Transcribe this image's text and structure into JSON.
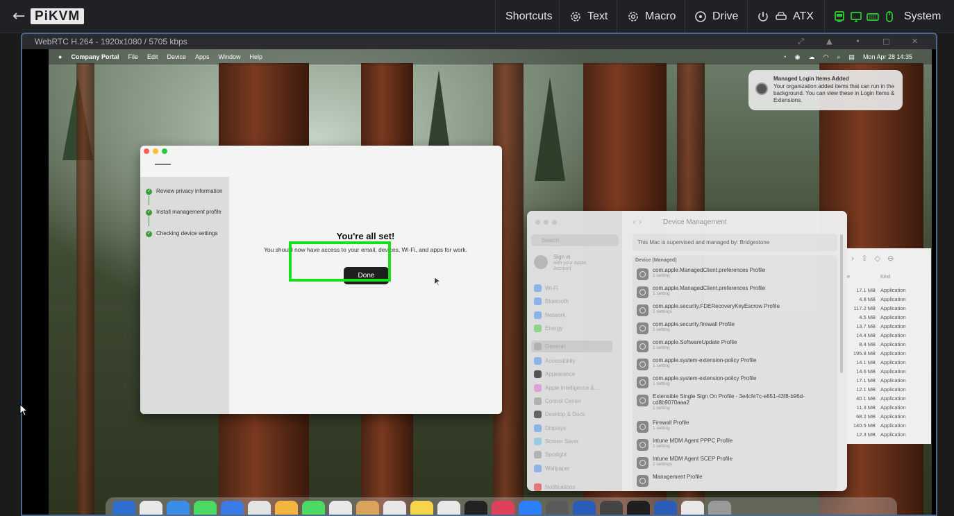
{
  "pikvm": {
    "logo": "PiKVM",
    "menu": {
      "shortcuts": "Shortcuts",
      "text": "Text",
      "macro": "Macro",
      "drive": "Drive",
      "atx": "ATX",
      "system": "System"
    }
  },
  "stream": {
    "info": "WebRTC H.264 - 1920x1080 / 5705 kbps"
  },
  "mac": {
    "menubar": {
      "app": "Company Portal",
      "items": [
        "File",
        "Edit",
        "Device",
        "Apps",
        "Window",
        "Help"
      ],
      "clock": "Mon Apr 28  14:35"
    },
    "notification": {
      "title": "Managed Login Items Added",
      "body": "Your organization added items that can run in the background. You can view these in Login Items & Extensions."
    },
    "company_portal": {
      "steps": [
        "Review privacy information",
        "Install management profile",
        "Checking device settings"
      ],
      "title": "You're all set!",
      "subtitle": "You should now have access to your email, devices, Wi-Fi, and apps for work.",
      "done_label": "Done"
    },
    "system_settings": {
      "search_placeholder": "Search",
      "signin": "Sign in",
      "signin_sub": "with your Apple Account",
      "sidebar": [
        "Wi-Fi",
        "Bluetooth",
        "Network",
        "Energy",
        "General",
        "Accessibility",
        "Appearance",
        "Apple Intelligence &...",
        "Control Center",
        "Desktop & Dock",
        "Displays",
        "Screen Saver",
        "Spotlight",
        "Wallpaper",
        "Notifications"
      ],
      "title": "Device Management",
      "supervised": "This Mac is supervised and managed by: Bridgestone",
      "list_header": "Device (Managed)",
      "profiles": [
        {
          "name": "com.apple.ManagedClient.preferences Profile",
          "settings": "1 setting"
        },
        {
          "name": "com.apple.ManagedClient.preferences Profile",
          "settings": "1 setting"
        },
        {
          "name": "com.apple.security.FDERecoveryKeyEscrow Profile",
          "settings": "2 settings"
        },
        {
          "name": "com.apple.security.firewall Profile",
          "settings": "1 setting"
        },
        {
          "name": "com.apple.SoftwareUpdate Profile",
          "settings": "1 setting"
        },
        {
          "name": "com.apple.system-extension-policy Profile",
          "settings": "1 setting"
        },
        {
          "name": "com.apple.system-extension-policy Profile",
          "settings": "1 setting"
        },
        {
          "name": "Extensible Single Sign On Profile - 3e4cfe7c-e851-43f8-b96d-cd8b9070aaa2",
          "settings": "1 setting"
        },
        {
          "name": "Firewall Profile",
          "settings": "1 setting"
        },
        {
          "name": "Intune MDM Agent PPPC Profile",
          "settings": "1 setting"
        },
        {
          "name": "Intune MDM Agent SCEP Profile",
          "settings": "2 settings"
        },
        {
          "name": "Management Profile",
          "settings": ""
        }
      ]
    },
    "finder": {
      "kind_header": "Kind",
      "size_header": "e",
      "rows": [
        {
          "size": "17.1 MB",
          "kind": "Application"
        },
        {
          "size": "4.8 MB",
          "kind": "Application"
        },
        {
          "size": "117.2 MB",
          "kind": "Application"
        },
        {
          "size": "4.5 MB",
          "kind": "Application"
        },
        {
          "size": "13.7 MB",
          "kind": "Application"
        },
        {
          "size": "14.4 MB",
          "kind": "Application"
        },
        {
          "size": "8.4 MB",
          "kind": "Application"
        },
        {
          "size": "195.8 MB",
          "kind": "Application"
        },
        {
          "size": "14.1 MB",
          "kind": "Application"
        },
        {
          "size": "14.6 MB",
          "kind": "Application"
        },
        {
          "size": "17.1 MB",
          "kind": "Application"
        },
        {
          "size": "12.1 MB",
          "kind": "Application"
        },
        {
          "size": "40.1 MB",
          "kind": "Application"
        },
        {
          "size": "11.3 MB",
          "kind": "Application"
        },
        {
          "size": "68.2 MB",
          "kind": "Application"
        },
        {
          "size": "140.5 MB",
          "kind": "Application"
        },
        {
          "size": "12.3 MB",
          "kind": "Application"
        }
      ]
    },
    "dock_colors": [
      "#2f6fd0",
      "#e8e8e8",
      "#3a8ee6",
      "#4cd964",
      "#3b7be8",
      "#e3e3e3",
      "#f5b342",
      "#4cd964",
      "#e8e8e8",
      "#d9a35b",
      "#e8e8e8",
      "#f6d54a",
      "#e8e8e8",
      "#222222",
      "#e0415a",
      "#2d7ff9",
      "#5a5a5a",
      "#2b5db8",
      "#444444",
      "#1f1f1f",
      "#2b5db8",
      "#e8e8e8",
      "#9a9a9a"
    ]
  },
  "colors": {
    "highlight": "#18e018",
    "topbar_bg": "#202124",
    "stream_border": "#4d6a8c"
  }
}
